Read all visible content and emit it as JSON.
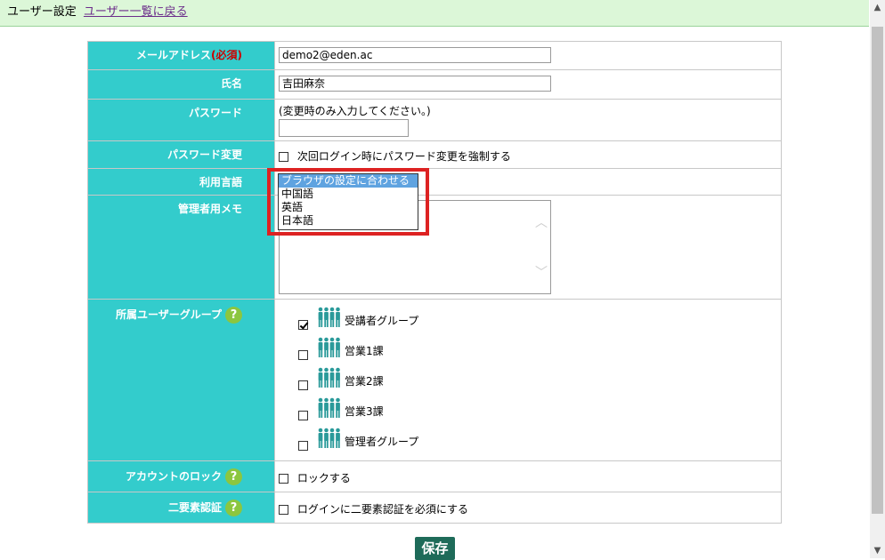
{
  "header": {
    "title": "ユーザー設定",
    "back_link": "ユーザー一覧に戻る"
  },
  "form": {
    "email": {
      "label": "メールアドレス",
      "required": "(必須)",
      "value": "demo2@eden.ac"
    },
    "name": {
      "label": "氏名",
      "value": "吉田麻奈"
    },
    "password": {
      "label": "パスワード",
      "hint": "(変更時のみ入力してください。)",
      "value": ""
    },
    "password_change": {
      "label": "パスワード変更",
      "checkbox_label": "次回ログイン時にパスワード変更を強制する",
      "checked": false
    },
    "language": {
      "label": "利用言語",
      "options": [
        "ブラウザの設定に合わせる",
        "中国語",
        "英語",
        "日本語"
      ],
      "selected": "ブラウザの設定に合わせる"
    },
    "memo": {
      "label": "管理者用メモ",
      "value": ""
    },
    "groups": {
      "label": "所属ユーザーグループ",
      "items": [
        {
          "name": "受講者グループ",
          "checked": true
        },
        {
          "name": "営業1課",
          "checked": false
        },
        {
          "name": "営業2課",
          "checked": false
        },
        {
          "name": "営業3課",
          "checked": false
        },
        {
          "name": "管理者グループ",
          "checked": false
        }
      ]
    },
    "account_lock": {
      "label": "アカウントのロック",
      "checkbox_label": "ロックする",
      "checked": false
    },
    "two_factor": {
      "label": "二要素認証",
      "checkbox_label": "ログインに二要素認証を必須にする",
      "checked": false
    }
  },
  "save_button": "保存",
  "help_icon_text": "?",
  "colors": {
    "label_bg": "#33cccc",
    "header_bg": "#dcf7d8",
    "button_bg": "#1e6b59",
    "highlight": "#dd2222",
    "accent_group_icon": "#2a9a9a"
  }
}
